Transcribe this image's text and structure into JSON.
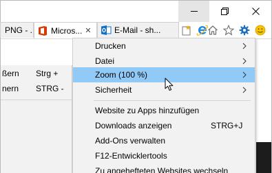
{
  "window": {
    "minimize_icon": "minimize-icon",
    "maximize_icon": "restore-icon",
    "close_icon": "close-icon"
  },
  "tabs": [
    {
      "title": "PNG - ...",
      "icon": "png-file-icon",
      "active": false
    },
    {
      "title": "Micros...",
      "close": "✕",
      "icon": "office-icon",
      "active": true
    },
    {
      "title": "E-Mail - sh...",
      "icon": "outlook-icon",
      "active": false
    }
  ],
  "toolbar": {
    "new_tab_icon": "new-tab-icon",
    "ie_icon": "internet-explorer-icon",
    "home_icon": "home-icon",
    "favorites_icon": "star-icon",
    "tools_icon": "gear-icon",
    "feedback_icon": "smiley-icon"
  },
  "zoom_submenu": {
    "items": [
      {
        "label": "ßern",
        "shortcut": "Strg +"
      },
      {
        "label": "nern",
        "shortcut": "STRG -"
      }
    ]
  },
  "menu": {
    "items": [
      {
        "label": "Drucken",
        "shortcut": "",
        "has_submenu": true,
        "highlight": false
      },
      {
        "label": "Datei",
        "shortcut": "",
        "has_submenu": true,
        "highlight": false
      },
      {
        "label": "Zoom (100 %)",
        "shortcut": "",
        "has_submenu": true,
        "highlight": true
      },
      {
        "label": "Sicherheit",
        "shortcut": "",
        "has_submenu": true,
        "highlight": false
      },
      {
        "label": "Website zu Apps hinzufügen",
        "shortcut": "",
        "has_submenu": false,
        "highlight": false
      },
      {
        "label": "Downloads anzeigen",
        "shortcut": "STRG+J",
        "has_submenu": false,
        "highlight": false
      },
      {
        "label": "Add-Ons verwalten",
        "shortcut": "",
        "has_submenu": false,
        "highlight": false
      },
      {
        "label": "F12-Entwicklertools",
        "shortcut": "",
        "has_submenu": false,
        "highlight": false
      },
      {
        "label": "Zu angehefteten Websites wechseln",
        "shortcut": "",
        "has_submenu": false,
        "highlight": false
      }
    ]
  },
  "colors": {
    "highlight": "#91c9f7",
    "menu_bg": "#f2f2f2",
    "tools_blue": "#1e6fc4",
    "office_orange": "#d83b01",
    "outlook_blue": "#0f6fc6",
    "ie_blue": "#1e88e5",
    "smiley_yellow": "#f7c600"
  }
}
